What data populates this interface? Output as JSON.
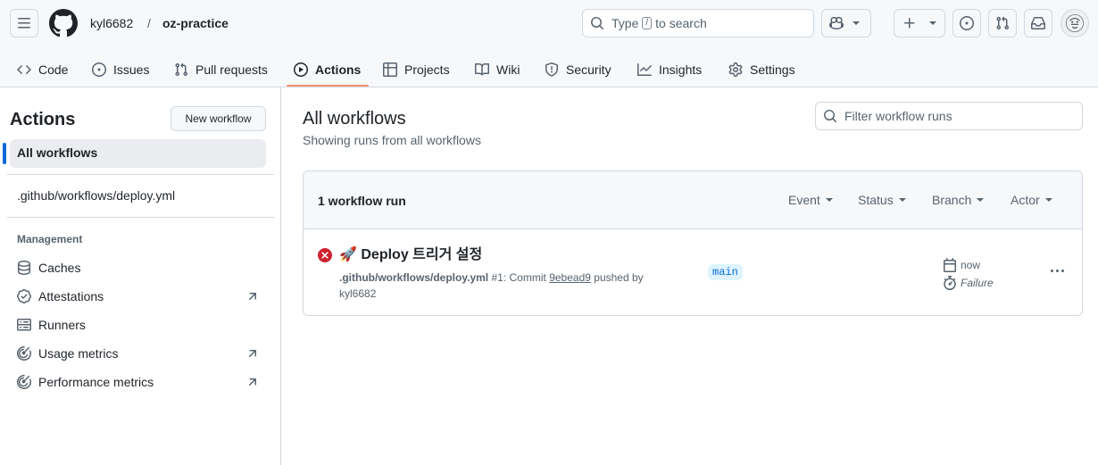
{
  "header": {
    "owner": "kyl6682",
    "separator": "/",
    "repo": "oz-practice",
    "search": {
      "prefix": "Type",
      "key": "/",
      "suffix": "to search"
    }
  },
  "repo_nav": {
    "items": [
      {
        "label": "Code",
        "icon": "code-icon"
      },
      {
        "label": "Issues",
        "icon": "issue-icon"
      },
      {
        "label": "Pull requests",
        "icon": "pull-request-icon"
      },
      {
        "label": "Actions",
        "icon": "play-icon",
        "active": true
      },
      {
        "label": "Projects",
        "icon": "table-icon"
      },
      {
        "label": "Wiki",
        "icon": "book-icon"
      },
      {
        "label": "Security",
        "icon": "shield-icon"
      },
      {
        "label": "Insights",
        "icon": "graph-icon"
      },
      {
        "label": "Settings",
        "icon": "gear-icon"
      }
    ]
  },
  "sidebar": {
    "title": "Actions",
    "new_workflow": "New workflow",
    "all_workflows": "All workflows",
    "workflows": [
      ".github/workflows/deploy.yml"
    ],
    "management_heading": "Management",
    "management": [
      {
        "label": "Caches",
        "icon": "database-icon",
        "external": false
      },
      {
        "label": "Attestations",
        "icon": "verified-icon",
        "external": true
      },
      {
        "label": "Runners",
        "icon": "server-icon",
        "external": false
      },
      {
        "label": "Usage metrics",
        "icon": "meter-icon",
        "external": true
      },
      {
        "label": "Performance metrics",
        "icon": "meter-icon",
        "external": true
      }
    ]
  },
  "main": {
    "title": "All workflows",
    "subtitle": "Showing runs from all workflows",
    "filter_placeholder": "Filter workflow runs",
    "run_count": "1 workflow run",
    "filters": [
      "Event",
      "Status",
      "Branch",
      "Actor"
    ],
    "runs": [
      {
        "emoji": "🚀",
        "title": "Deploy 트리거 설정",
        "workflow": ".github/workflows/deploy.yml",
        "run_number": "#1",
        "event_text": "Commit",
        "sha": "9ebead9",
        "pushed_by": "pushed by",
        "actor": "kyl6682",
        "branch": "main",
        "time": "now",
        "status": "Failure",
        "status_color": "#cf222e"
      }
    ]
  },
  "colors": {
    "accent_underline": "#fd8c73",
    "active_bar": "#0969da",
    "failure": "#cf222e",
    "branch_bg": "#ddf4ff"
  }
}
